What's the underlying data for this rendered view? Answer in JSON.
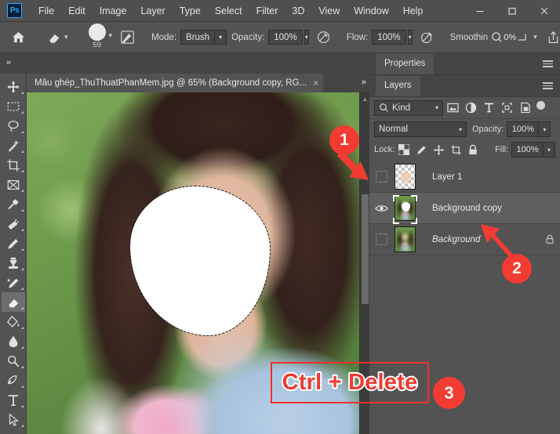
{
  "app": {
    "logo_text": "Ps",
    "menus": [
      "File",
      "Edit",
      "Image",
      "Layer",
      "Type",
      "Select",
      "Filter",
      "3D",
      "View",
      "Window",
      "Help"
    ],
    "window_controls": [
      "minimize",
      "maximize",
      "close"
    ]
  },
  "options_bar": {
    "home_icon": "home-icon",
    "tool_preset_icon": "eraser-icon",
    "brush_size": "59",
    "brush_panel_icon": "brush-settings-icon",
    "mode_label": "Mode:",
    "mode_value": "Brush",
    "opacity_label": "Opacity:",
    "opacity_value": "100%",
    "pressure_opacity_icon": "pressure-opacity-icon",
    "flow_label": "Flow:",
    "flow_value": "100%",
    "airbrush_icon": "airbrush-icon",
    "smoothing_label": "Smoothin",
    "smoothing_value": "0%",
    "share_icon": "share-icon"
  },
  "document": {
    "tab_title": "Mẫu ghép_ThuThuatPhanMem.jpg @ 65% (Background copy, RG...",
    "close_icon": "close-icon",
    "overflow_icon": "chevron-double-right-icon"
  },
  "toolbar": {
    "items": [
      {
        "name": "move-tool",
        "icon": "move-icon",
        "active": false
      },
      {
        "name": "rectangular-marquee-tool",
        "icon": "marquee-icon",
        "active": false
      },
      {
        "name": "lasso-tool",
        "icon": "lasso-icon",
        "active": false
      },
      {
        "name": "magic-wand-tool",
        "icon": "magic-wand-icon",
        "active": false
      },
      {
        "name": "crop-tool",
        "icon": "crop-icon",
        "active": false
      },
      {
        "name": "frame-tool",
        "icon": "frame-icon",
        "active": false
      },
      {
        "name": "eyedropper-tool",
        "icon": "eyedropper-icon",
        "active": false
      },
      {
        "name": "spot-healing-brush-tool",
        "icon": "healing-brush-icon",
        "active": false
      },
      {
        "name": "brush-tool",
        "icon": "brush-icon",
        "active": false
      },
      {
        "name": "clone-stamp-tool",
        "icon": "clone-stamp-icon",
        "active": false
      },
      {
        "name": "history-brush-tool",
        "icon": "history-brush-icon",
        "active": false
      },
      {
        "name": "eraser-tool",
        "icon": "eraser-icon",
        "active": true
      },
      {
        "name": "gradient-tool",
        "icon": "paint-bucket-icon",
        "active": false
      },
      {
        "name": "blur-tool",
        "icon": "blur-drop-icon",
        "active": false
      },
      {
        "name": "dodge-tool",
        "icon": "dodge-icon",
        "active": false
      },
      {
        "name": "pen-tool",
        "icon": "pen-icon",
        "active": false
      },
      {
        "name": "type-tool",
        "icon": "type-icon",
        "active": false
      },
      {
        "name": "path-selection-tool",
        "icon": "path-select-icon",
        "active": false
      }
    ]
  },
  "panels": {
    "properties_tab": "Properties",
    "layers_tab": "Layers",
    "menu_icon": "panel-menu-icon"
  },
  "layers_panel": {
    "filter_search_icon": "search-icon",
    "kind_label": "Kind",
    "filter_icons": [
      "pixel-layer-filter-icon",
      "adjustment-layer-filter-icon",
      "type-layer-filter-icon",
      "shape-layer-filter-icon",
      "smart-object-filter-icon"
    ],
    "filter_toggle_icon": "filter-toggle-icon",
    "blend_mode": "Normal",
    "opacity_label": "Opacity:",
    "opacity_value": "100%",
    "lock_label": "Lock:",
    "lock_icons": [
      "lock-transparent-pixels-icon",
      "lock-image-pixels-icon",
      "lock-position-icon",
      "lock-artboard-nesting-icon",
      "lock-all-icon"
    ],
    "fill_label": "Fill:",
    "fill_value": "100%",
    "layers": [
      {
        "name": "Layer 1",
        "visible": false,
        "selected": false,
        "locked": false,
        "italic": false,
        "thumb": "transparent-checker"
      },
      {
        "name": "Background copy",
        "visible": true,
        "selected": true,
        "locked": false,
        "italic": false,
        "thumb": "photo-with-white-face"
      },
      {
        "name": "Background",
        "visible": false,
        "selected": false,
        "locked": true,
        "italic": true,
        "thumb": "photo"
      }
    ]
  },
  "annotations": {
    "badge_1": "1",
    "badge_2": "2",
    "badge_3": "3",
    "shortcut_text": "Ctrl + Delete",
    "accent_color": "#f23b32",
    "highlight_border_color": "#e8332a",
    "shortcut_text_color": "#ef3b31"
  },
  "canvas": {
    "selection_label": "face-selection-marching-ants",
    "scrollbar": "vertical-scrollbar"
  }
}
